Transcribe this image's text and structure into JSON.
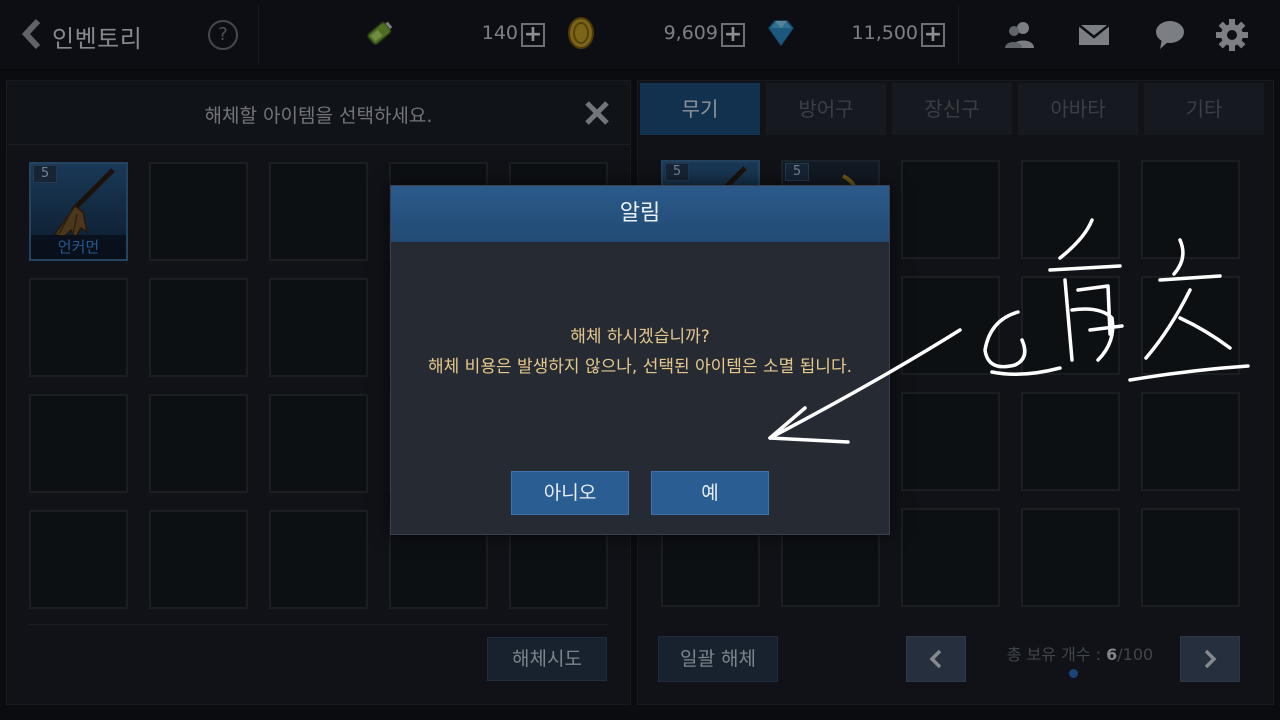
{
  "topbar": {
    "title": "인벤토리",
    "help_label": "?",
    "resources": [
      {
        "icon": "energy-battery-icon",
        "value": "140"
      },
      {
        "icon": "gold-coin-icon",
        "value": "9,609"
      },
      {
        "icon": "diamond-gem-icon",
        "value": "11,500"
      }
    ],
    "plus_label": "+",
    "icons": [
      "friends-icon",
      "mail-icon",
      "chat-icon",
      "settings-gear-icon"
    ]
  },
  "left_panel": {
    "header": "해체할 아이템을 선택하세요.",
    "selected_item": {
      "count": "5",
      "name": "언커먼"
    },
    "dismantle_try_button": "해체시도"
  },
  "right_panel": {
    "tabs": [
      "무기",
      "방어구",
      "장신구",
      "아바타",
      "기타"
    ],
    "active_tab": "무기",
    "item_counts": [
      "5",
      "5"
    ],
    "bulk_dismantle_button": "일괄 해체",
    "count_label": "총 보유 개수 : ",
    "count_current": "6",
    "count_max": "/100"
  },
  "modal": {
    "title": "알림",
    "line1": "해체 하시겠습니까?",
    "line2": "해체 비용은 발생하지 않으나, 선택된 아이템은 소멸 됩니다.",
    "no_button": "아니오",
    "yes_button": "예"
  },
  "colors": {
    "accent_blue": "#2a5d92",
    "message_gold": "#e6c88e",
    "rarity_uncommon": "#3e8fe0"
  }
}
